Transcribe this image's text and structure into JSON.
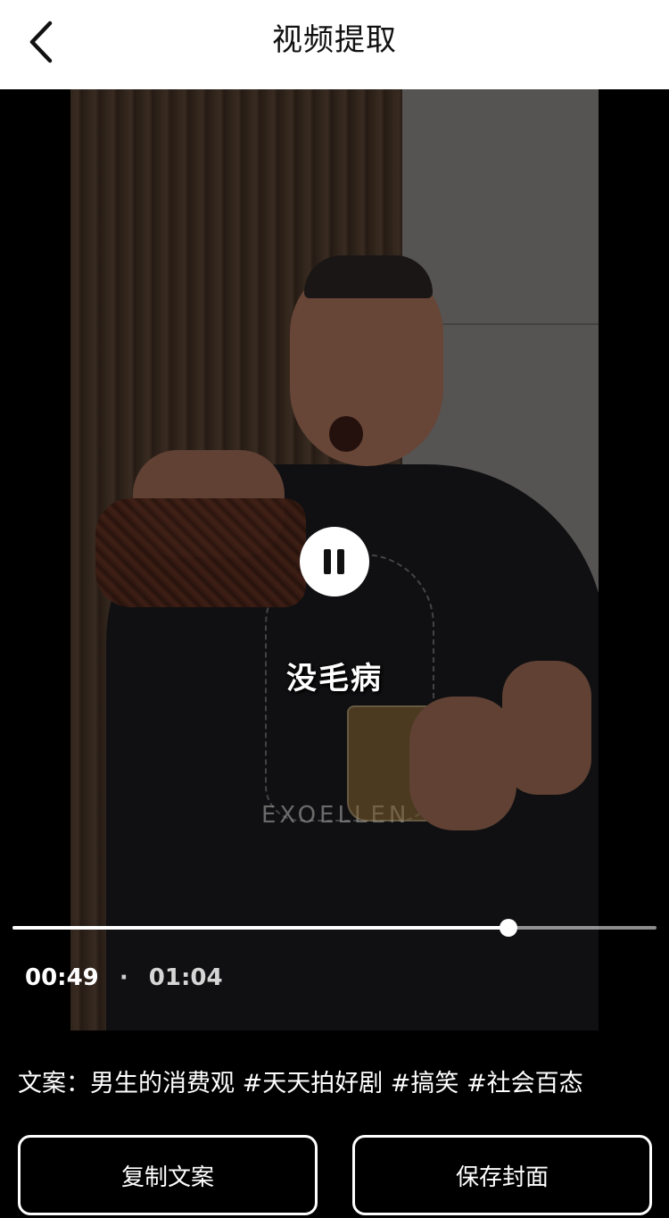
{
  "header": {
    "title": "视频提取"
  },
  "video": {
    "overlay_caption": "没毛病",
    "shirt_text": "EXOELLEN",
    "current_time": "00:49",
    "separator": "·",
    "total_time": "01:04",
    "progress_percent": 77
  },
  "copy": {
    "text": "文案：男生的消费观 #天天拍好剧 #搞笑 #社会百态"
  },
  "buttons": {
    "copy_label": "复制文案",
    "save_label": "保存封面"
  },
  "icons": {
    "back": "chevron-left-icon",
    "pause": "pause-icon"
  }
}
